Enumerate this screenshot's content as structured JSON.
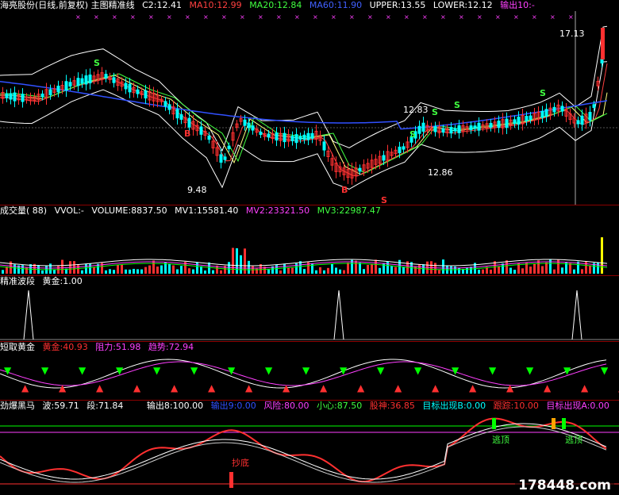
{
  "colors": {
    "bg": "#000000",
    "up": "#ff3030",
    "down": "#00ffff",
    "ma10": "#ff4040",
    "ma20": "#40ff40",
    "ma60": "#3050ff",
    "boll": "#ffffff",
    "yellow": "#ffff00",
    "magenta": "#ff40ff",
    "green": "#00ff00",
    "cyan": "#00ffff",
    "separator": "#8b0000"
  },
  "main": {
    "title": "海亮股份(日线,前复权) 主图精准线",
    "c2": "C2:12.41",
    "ma10": "MA10:12.99",
    "ma20": "MA20:12.84",
    "ma60": "MA60:11.90",
    "upper": "UPPER:13.55",
    "lower": "LOWER:12.12",
    "out10": "输出10:-",
    "price_high": "17.13",
    "price_low": "9.48",
    "price_1283": "12.83",
    "price_1286": "12.86",
    "s_marker": "S",
    "b_marker": "B"
  },
  "volume": {
    "title": "成交量( 88)",
    "vvol": "VVOL:-",
    "volume": "VOLUME:8837.50",
    "mv1": "MV1:15581.40",
    "mv2": "MV2:23321.50",
    "mv3": "MV3:22987.47"
  },
  "wave": {
    "title": "精准波段",
    "gold": "黄金:1.00"
  },
  "gold_pane": {
    "title": "短取黄金",
    "gold": "黄金:40.93",
    "resist": "阻力:51.98",
    "trend": "趋势:72.94"
  },
  "horse": {
    "title": "劲爆黑马",
    "bo": "波:59.71",
    "duan": "段:71.84",
    "out8": "输出8:100.00",
    "out9": "输出9:0.00",
    "risk": "风险:80.00",
    "careful": "小心:87.50",
    "gushen": "股神:36.85",
    "targetB": "目标出现B:0.00",
    "follow": "跟踪:10.00",
    "targetA": "目标出现A:0.00",
    "chaodi": "抄底",
    "taoding": "逃顶"
  },
  "watermark": "178448.com"
}
